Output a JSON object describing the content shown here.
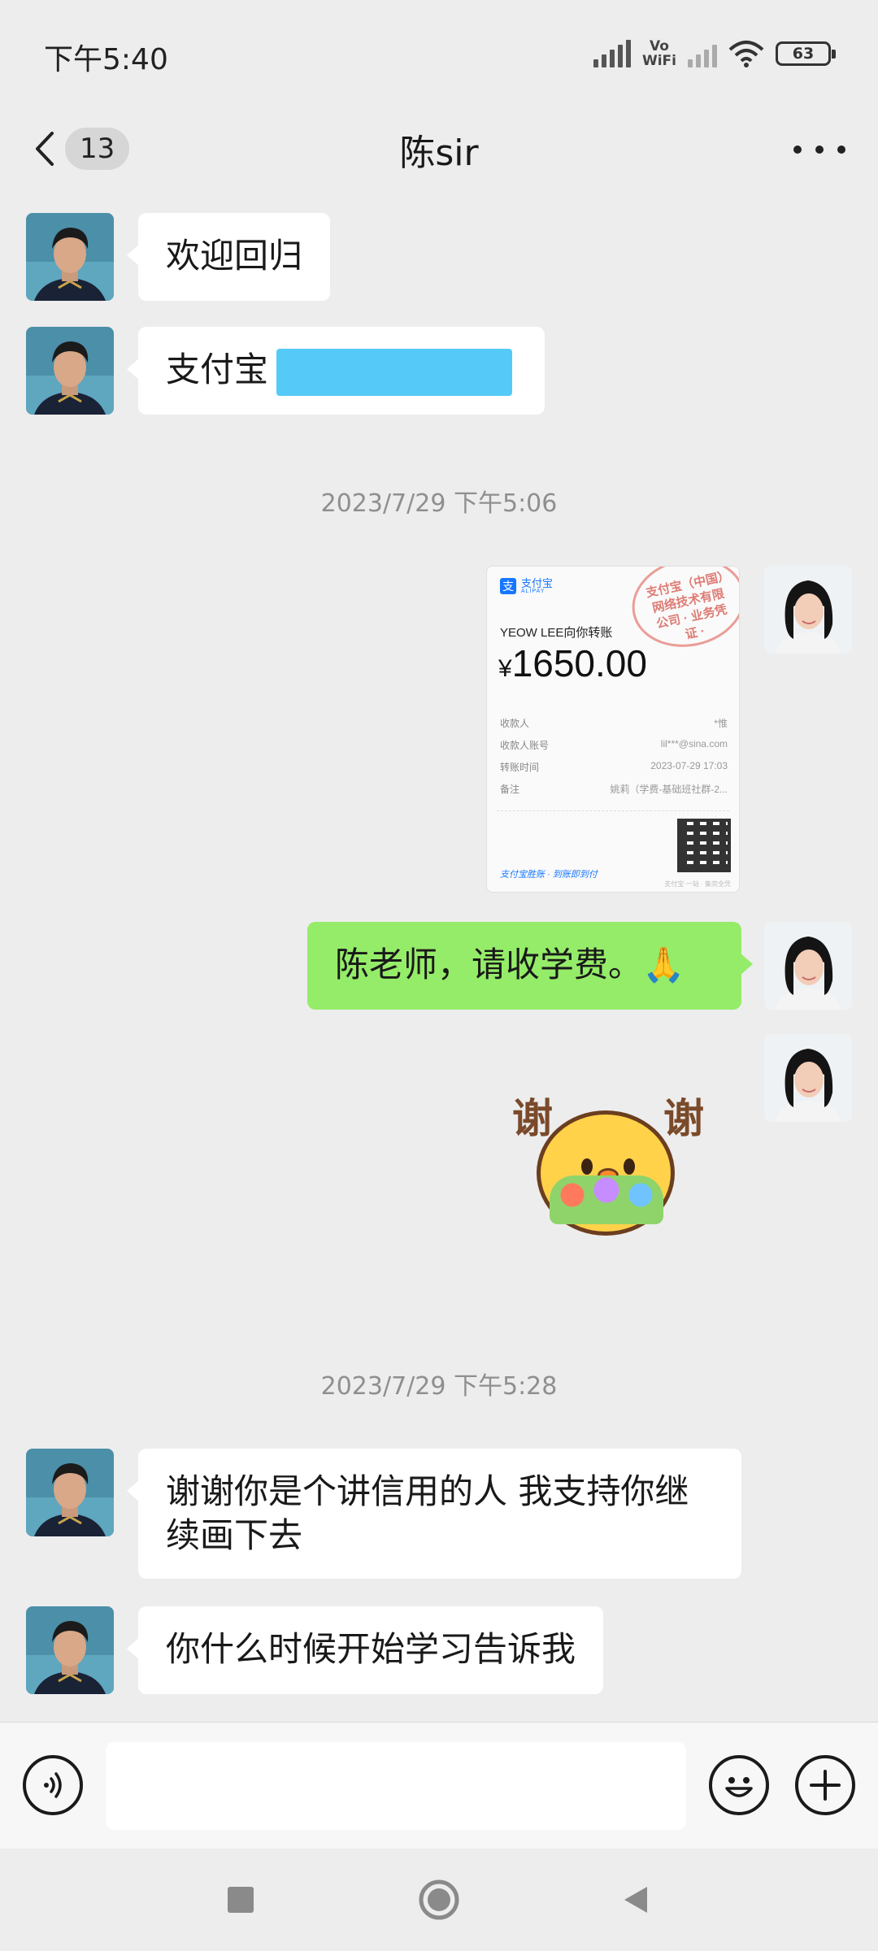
{
  "status_bar": {
    "time": "下午5:40",
    "vowifi_line1": "Vo",
    "vowifi_line2": "WiFi",
    "battery": "63"
  },
  "header": {
    "back_count": "13",
    "title": "陈sir"
  },
  "messages": [
    {
      "side": "left",
      "type": "text",
      "text": "欢迎回归"
    },
    {
      "side": "left",
      "type": "text",
      "text": "支付宝"
    },
    {
      "type": "timestamp",
      "text": "2023/7/29 下午5:06"
    },
    {
      "side": "right",
      "type": "image",
      "receipt": {
        "logo_text": "支付宝",
        "logo_sub": "ALIPAY",
        "stamp_text": "支付宝（中国）网络技术有限公司 · 业务凭证 ·",
        "title": "YEOW LEE向你转账",
        "currency": "¥",
        "amount": "1650.00",
        "rows": [
          {
            "label": "收款人",
            "value": "*惟"
          },
          {
            "label": "收款人账号",
            "value": "lil***@sina.com"
          },
          {
            "label": "转账时间",
            "value": "2023-07-29 17:03"
          },
          {
            "label": "备注",
            "value": "姚莉（学费-基础班社群-2..."
          }
        ],
        "footer": "支付宝胜账 · 到账即到付",
        "footer_small": "支付宝·一站 · 集完全凭"
      }
    },
    {
      "side": "right",
      "type": "text",
      "text": "陈老师，请收学费。🙏"
    },
    {
      "side": "right",
      "type": "sticker",
      "sticker_words": [
        "谢",
        "谢"
      ]
    },
    {
      "type": "timestamp",
      "text": "2023/7/29 下午5:28"
    },
    {
      "side": "left",
      "type": "text",
      "text": "谢谢你是个讲信用的人 我支持你继续画下去"
    },
    {
      "side": "left",
      "type": "text",
      "text": "你什么时候开始学习告诉我"
    }
  ],
  "input_bar": {
    "voice_icon": "voice-icon",
    "emoji_icon": "emoji-icon",
    "plus_icon": "plus-icon",
    "placeholder": ""
  },
  "colors": {
    "background": "#ededed",
    "bubble_self": "#95ec69",
    "bubble_other": "#ffffff",
    "redaction": "#4cc7f8"
  }
}
